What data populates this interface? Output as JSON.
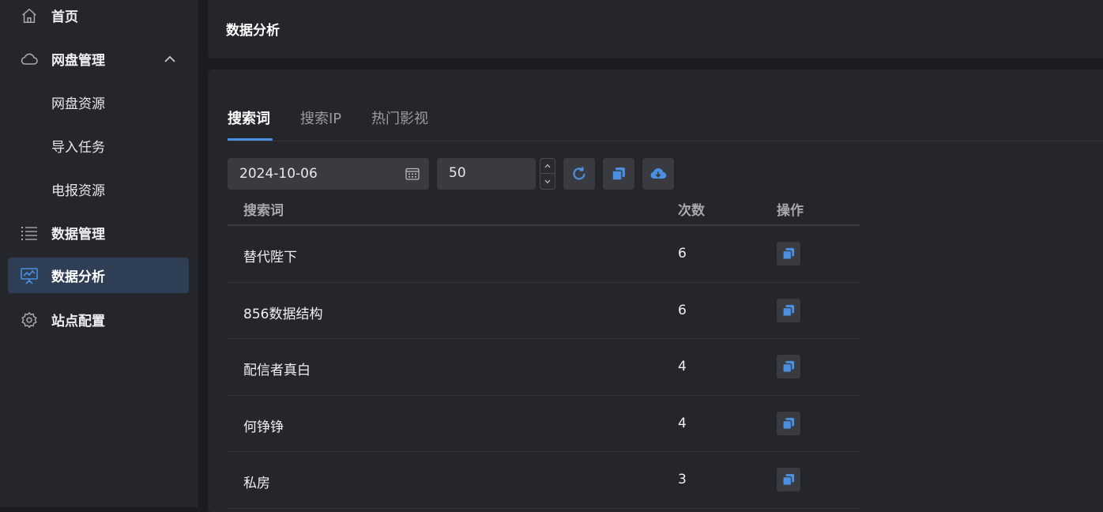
{
  "sidebar": {
    "items": [
      {
        "label": "首页",
        "icon": "home-icon"
      },
      {
        "label": "网盘管理",
        "icon": "cloud-icon",
        "expanded": true
      },
      {
        "label": "数据管理",
        "icon": "list-icon"
      },
      {
        "label": "数据分析",
        "icon": "chart-board-icon",
        "active": true
      },
      {
        "label": "站点配置",
        "icon": "gear-icon"
      }
    ],
    "subitems": [
      {
        "label": "网盘资源"
      },
      {
        "label": "导入任务"
      },
      {
        "label": "电报资源"
      }
    ]
  },
  "header": {
    "title": "数据分析"
  },
  "tabs": [
    {
      "label": "搜索词",
      "active": true
    },
    {
      "label": "搜索IP"
    },
    {
      "label": "热门影视"
    }
  ],
  "filters": {
    "date": "2024-10-06",
    "limit": "50"
  },
  "table": {
    "headers": [
      "搜索词",
      "次数",
      "操作"
    ],
    "rows": [
      {
        "term": "替代陛下",
        "count": "6"
      },
      {
        "term": "856数据结构",
        "count": "6"
      },
      {
        "term": "配信者真白",
        "count": "4"
      },
      {
        "term": "何铮铮",
        "count": "4"
      },
      {
        "term": "私房",
        "count": "3"
      }
    ]
  },
  "colors": {
    "accent": "#4a90e2",
    "active_bg": "#2e3e55",
    "sidebar_bg": "#25262b",
    "page_bg": "#1b1c20"
  }
}
